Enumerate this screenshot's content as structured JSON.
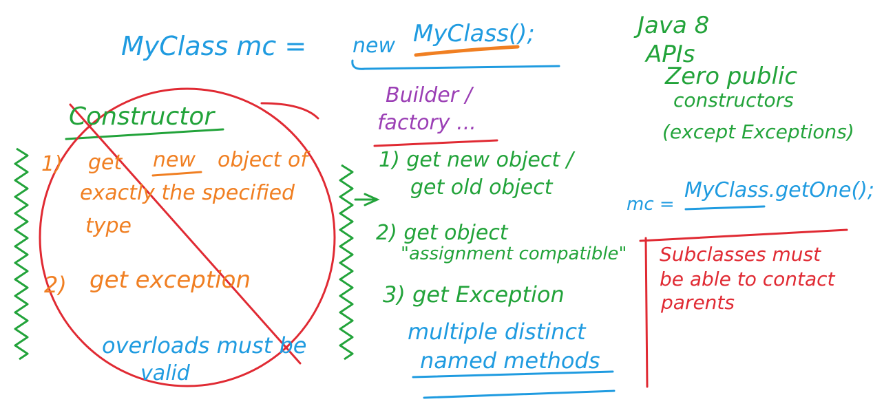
{
  "title": {
    "decl": "MyClass mc =",
    "new_keyword": "new",
    "ctor_call": "MyClass();"
  },
  "builder": {
    "line1": "Builder /",
    "line2": "factory ..."
  },
  "java8": {
    "line1": "Java 8",
    "line2": "APIs",
    "line3": "Zero public",
    "line4": "constructors",
    "line5": "(except Exceptions)"
  },
  "constructor_section": {
    "heading": "Constructor",
    "point1_num": "1)",
    "point1_line1_a": "get",
    "point1_line1_new": "new",
    "point1_line1_b": "object of",
    "point1_line2": "exactly the specified",
    "point1_line3": "type",
    "point2_num": "2)",
    "point2": "get exception",
    "overloads_line1": "overloads must be",
    "overloads_line2": "valid"
  },
  "factory_section": {
    "point1_line1": "1) get new object /",
    "point1_line2": "get old object",
    "point2_line1": "2) get object",
    "point2_line2": "\"assignment compatible\"",
    "point3": "3) get Exception",
    "multiple_line1": "multiple distinct",
    "multiple_line2": "named methods"
  },
  "getone": {
    "prefix": "mc =",
    "call": "MyClass.getOne();"
  },
  "subclass_note": {
    "line1": "Subclasses must",
    "line2": "be able to contact",
    "line3": "parents"
  },
  "colors": {
    "blue": "#1f9be0",
    "green": "#22a33a",
    "orange": "#f07f22",
    "purple": "#9b3fb5",
    "red": "#e02a33"
  }
}
